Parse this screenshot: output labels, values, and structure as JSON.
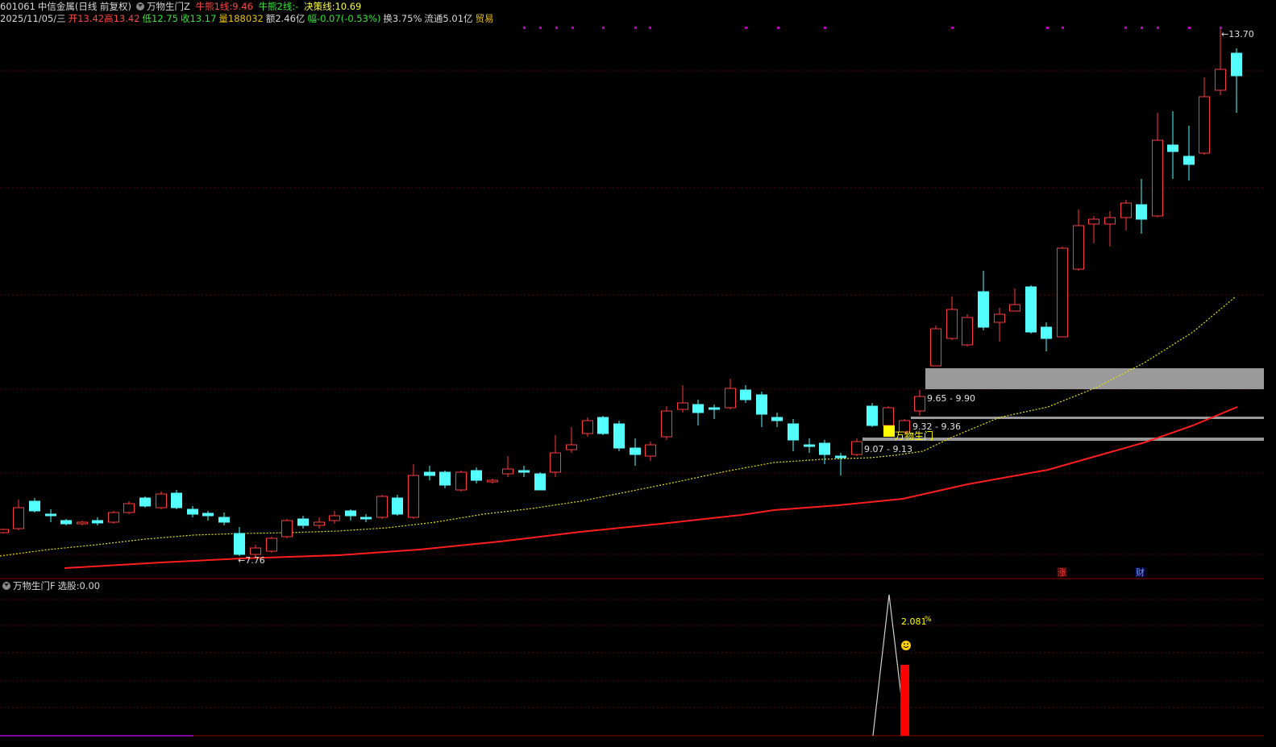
{
  "header": {
    "code": "601061",
    "name": "中信金属",
    "period": "(日线 前复权)",
    "indicator_name": "万物生门Z",
    "bull1_label": "牛熊1线:",
    "bull1_value": "9.46",
    "bull2_label": "牛熊2线:",
    "bull2_value": "-",
    "decision_label": "决策线:",
    "decision_value": "10.69"
  },
  "quote": {
    "date": "2025/11/05/三",
    "open_label": "开",
    "open": "13.42",
    "high_label": "高",
    "high": "13.42",
    "low_label": "低",
    "low": "12.75",
    "close_label": "收",
    "close": "13.17",
    "volume_label": "量",
    "volume": "188032",
    "amount_label": "额",
    "amount": "2.46亿",
    "change_label": "幅",
    "change": "-0.07(-0.53%)",
    "turnover_label": "换",
    "turnover": "3.75%",
    "float_label": "流通",
    "float": "5.01亿",
    "sector": "贸易"
  },
  "main_chart": {
    "high_marker": "13.70",
    "low_marker": "7.76",
    "zone_labels": [
      "9.65 - 9.90",
      "9.32 - 9.36",
      "9.07 - 9.13"
    ],
    "signal_label": "万物生门",
    "event_tags": [
      "涨",
      "财"
    ]
  },
  "sub_panel": {
    "title": "万物生门F",
    "select_label": "选股:",
    "select_value": "0.00",
    "peak_label": "2.081",
    "peak_unit": "%"
  },
  "colors": {
    "up": "#ff3c3c",
    "down": "#54ffff",
    "ma_long": "#ff1e1e",
    "ma_short": "#e6e600",
    "grid": "#5a0000",
    "zone": "#9a9a9a",
    "signal": "#ffff00",
    "marker": "#c000c0"
  },
  "icons": [
    "dropdown-circle-icon",
    "smiley-icon"
  ]
}
